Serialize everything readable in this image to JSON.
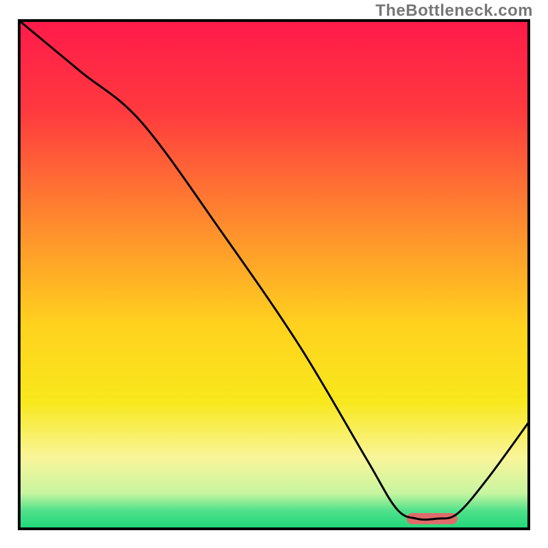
{
  "watermark": "TheBottleneck.com",
  "chart_data": {
    "type": "line",
    "title": "",
    "xlabel": "",
    "ylabel": "",
    "xlim": [
      0,
      100
    ],
    "ylim": [
      0,
      100
    ],
    "grid": false,
    "background_gradient": {
      "stops": [
        {
          "offset": 0.0,
          "color": "#ff1a4a"
        },
        {
          "offset": 0.18,
          "color": "#ff3a3f"
        },
        {
          "offset": 0.4,
          "color": "#ff8b2e"
        },
        {
          "offset": 0.6,
          "color": "#ffd21e"
        },
        {
          "offset": 0.75,
          "color": "#f8e81c"
        },
        {
          "offset": 0.86,
          "color": "#f9f59a"
        },
        {
          "offset": 0.93,
          "color": "#c8f5a0"
        },
        {
          "offset": 0.965,
          "color": "#4fe08a"
        },
        {
          "offset": 1.0,
          "color": "#1fd87a"
        }
      ]
    },
    "series": [
      {
        "name": "bottleneck-curve",
        "color": "#000000",
        "x": [
          0,
          12,
          24,
          40,
          55,
          68,
          74,
          78,
          82,
          86,
          92,
          100
        ],
        "values": [
          100,
          90,
          80,
          58,
          36,
          14,
          4,
          2,
          2,
          3,
          10,
          21
        ]
      }
    ],
    "markers": [
      {
        "name": "optimal-range",
        "shape": "rounded-bar",
        "color": "#e06b6b",
        "x_range": [
          76,
          86
        ],
        "y": 2,
        "height": 2.2
      }
    ],
    "border": {
      "color": "#000000",
      "width": 4
    }
  }
}
